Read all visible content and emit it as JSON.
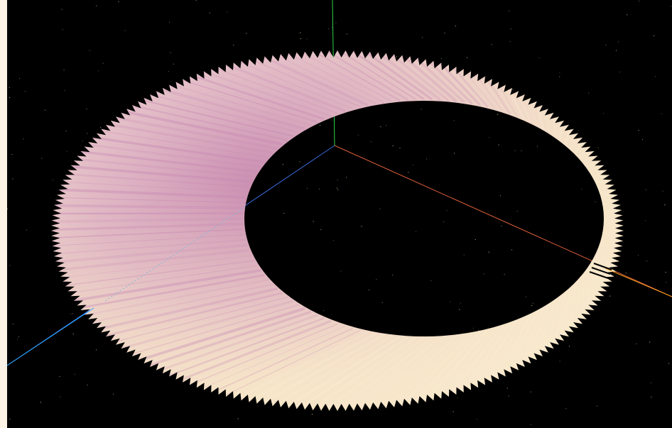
{
  "viewport": {
    "background_color": "#000000",
    "side_panel_color": "#fdf2e6",
    "star_color": "#c8c8a0",
    "icon_name": "3d-viewport"
  },
  "axes": {
    "x_color": "#e0603a",
    "y_color": "#2fd24a",
    "z_color": "#3a6ee0",
    "x_far_color": "#ffa41e",
    "z_far_color": "#2aa9ff"
  },
  "ring": {
    "base_color": "#f7e8c8",
    "shade_color": "#c889b4",
    "highlight_color": "#fff2d8",
    "teeth_count": 220
  }
}
